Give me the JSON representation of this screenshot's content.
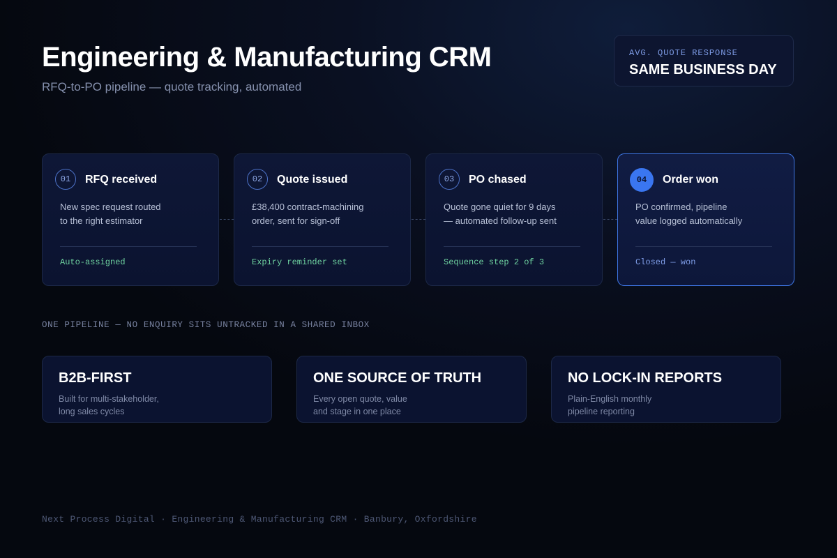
{
  "header": {
    "title": "Engineering & Manufacturing CRM",
    "subtitle": "RFQ-to-PO pipeline — quote tracking, automated"
  },
  "badge": {
    "label": "AVG. QUOTE RESPONSE",
    "value": "SAME BUSINESS DAY"
  },
  "steps": [
    {
      "number": "01",
      "title": "RFQ received",
      "description": [
        "New spec request routed",
        "to the right estimator"
      ],
      "status": "Auto-assigned"
    },
    {
      "number": "02",
      "title": "Quote issued",
      "description": [
        "£38,400 contract-machining",
        "order, sent for sign-off"
      ],
      "status": "Expiry reminder set"
    },
    {
      "number": "03",
      "title": "PO chased",
      "description": [
        "Quote gone quiet for 9 days",
        "— automated follow-up sent"
      ],
      "status": "Sequence step 2 of 3"
    },
    {
      "number": "04",
      "title": "Order won",
      "description": [
        "PO confirmed, pipeline",
        "value logged automatically"
      ],
      "status": "Closed — won",
      "active": true
    }
  ],
  "section_label": "ONE PIPELINE — NO ENQUIRY SITS UNTRACKED IN A SHARED INBOX",
  "features": [
    {
      "title": "B2B-FIRST",
      "description": [
        "Built for multi-stakeholder,",
        "long sales cycles"
      ]
    },
    {
      "title": "ONE SOURCE OF TRUTH",
      "description": [
        "Every open quote, value",
        "and stage in one place"
      ]
    },
    {
      "title": "NO LOCK-IN REPORTS",
      "description": [
        "Plain-English monthly",
        "pipeline reporting"
      ]
    }
  ],
  "footer": "Next Process Digital · Engineering & Manufacturing CRM · Banbury, Oxfordshire",
  "colors": {
    "background": "#05080f",
    "accent": "#3a76f0",
    "status_green": "#6fd3a0",
    "status_blue": "#7e9ce6"
  }
}
